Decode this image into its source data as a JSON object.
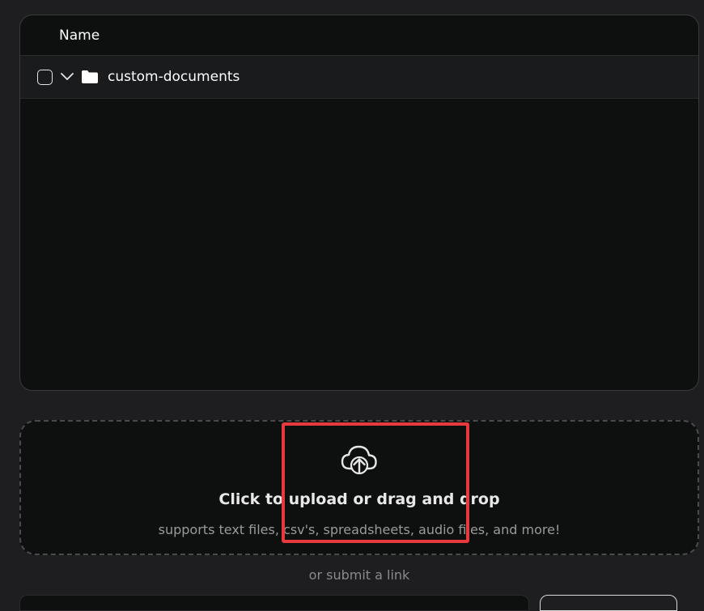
{
  "table": {
    "header_name": "Name",
    "rows": [
      {
        "name": "custom-documents",
        "checked": false,
        "icon": "folder-icon",
        "expand_icon": "chevron-down-icon"
      }
    ]
  },
  "dropzone": {
    "icon": "cloud-upload-icon",
    "title": "Click to upload or drag and drop",
    "subtitle": "supports text files, csv's, spreadsheets, audio files, and more!"
  },
  "link_section": {
    "label": "or submit a link"
  },
  "colors": {
    "background": "#1e1e20",
    "panel": "#0e0f0f",
    "row": "#1a1b1c",
    "highlight": "#e8393f"
  }
}
